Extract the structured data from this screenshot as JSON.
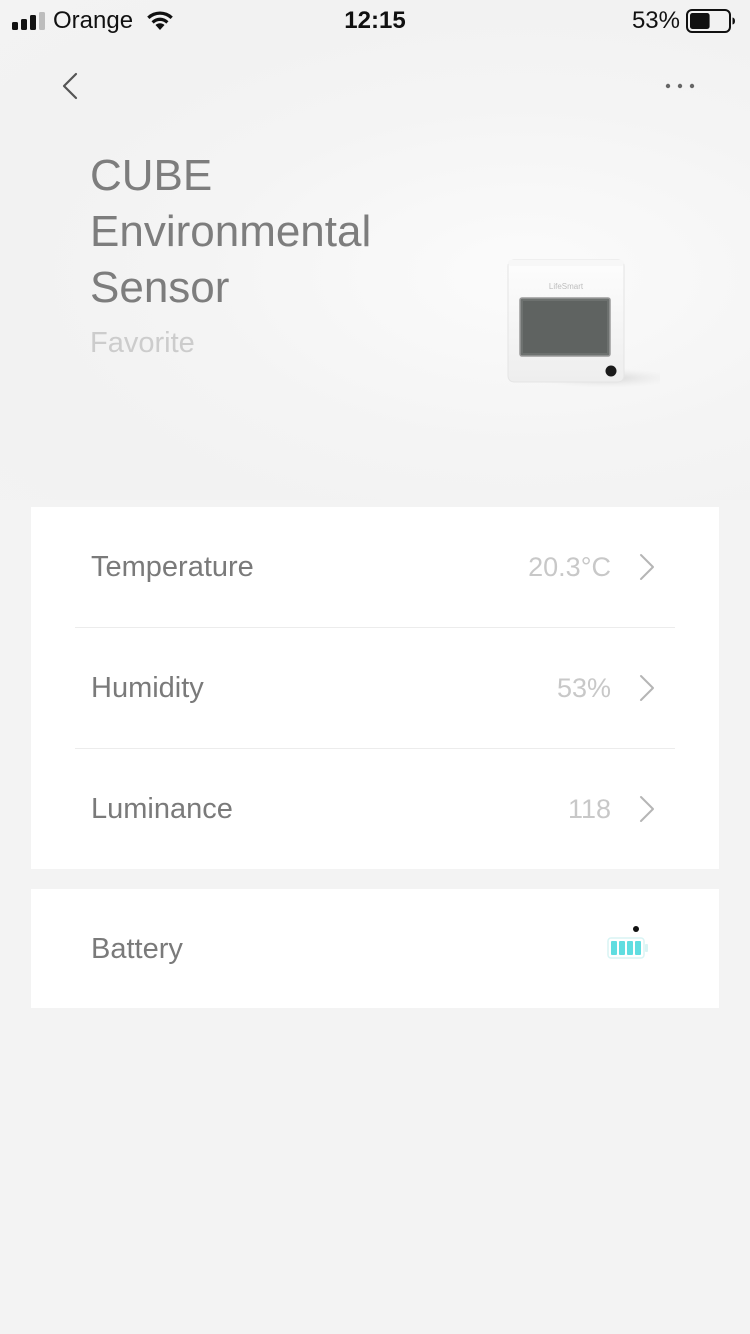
{
  "status_bar": {
    "carrier": "Orange",
    "time": "12:15",
    "battery_percent": "53%",
    "battery_level": 0.53,
    "signal_bars": 3,
    "signal_total": 4
  },
  "nav": {
    "back_icon": "chevron-left-icon",
    "more_icon": "ellipsis-icon"
  },
  "device": {
    "title_lines": [
      "CUBE",
      "Environmental",
      "Sensor"
    ],
    "favorite_label": "Favorite",
    "image_brand": "LifeSmart"
  },
  "readings": [
    {
      "label": "Temperature",
      "value": "20.3°C"
    },
    {
      "label": "Humidity",
      "value": "53%"
    },
    {
      "label": "Luminance",
      "value": "118"
    }
  ],
  "battery": {
    "label": "Battery",
    "level": 1.0,
    "color": "#5fdde0"
  },
  "colors": {
    "background": "#f3f3f3",
    "card": "#ffffff",
    "label": "#7a7a7a",
    "value": "#c8c8c8",
    "title": "#7d7d7d",
    "favorite": "#cccccc"
  }
}
